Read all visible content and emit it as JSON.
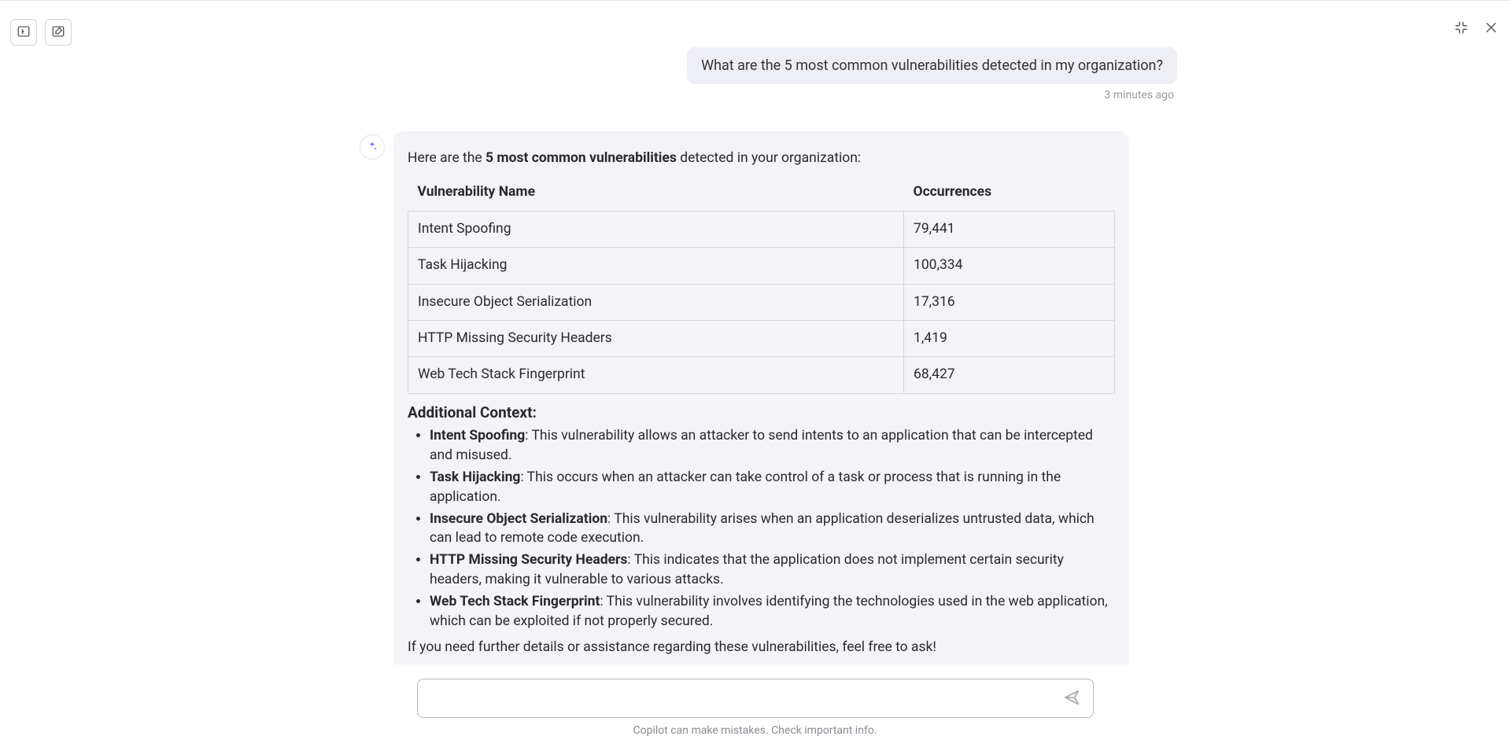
{
  "conversation": {
    "userMessage": "What are the 5 most common vulnerabilities detected in my organization?",
    "userTimestamp": "3 minutes ago",
    "assistant": {
      "intro_before": "Here are the ",
      "intro_bold": "5 most common vulnerabilities",
      "intro_after": " detected in your organization:",
      "table": {
        "headers": {
          "name": "Vulnerability Name",
          "occ": "Occurrences"
        },
        "rows": [
          {
            "name": "Intent Spoofing",
            "occ": "79,441"
          },
          {
            "name": "Task Hijacking",
            "occ": "100,334"
          },
          {
            "name": "Insecure Object Serialization",
            "occ": "17,316"
          },
          {
            "name": "HTTP Missing Security Headers",
            "occ": "1,419"
          },
          {
            "name": "Web Tech Stack Fingerprint",
            "occ": "68,427"
          }
        ]
      },
      "contextHeading": "Additional Context:",
      "contextItems": [
        {
          "term": "Intent Spoofing",
          "desc": ": This vulnerability allows an attacker to send intents to an application that can be intercepted and misused."
        },
        {
          "term": "Task Hijacking",
          "desc": ": This occurs when an attacker can take control of a task or process that is running in the application."
        },
        {
          "term": "Insecure Object Serialization",
          "desc": ": This vulnerability arises when an application deserializes untrusted data, which can lead to remote code execution."
        },
        {
          "term": "HTTP Missing Security Headers",
          "desc": ": This indicates that the application does not implement certain security headers, making it vulnerable to various attacks."
        },
        {
          "term": "Web Tech Stack Fingerprint",
          "desc": ": This vulnerability involves identifying the technologies used in the web application, which can be exploited if not properly secured."
        }
      ],
      "closing": "If you need further details or assistance regarding these vulnerabilities, feel free to ask!"
    }
  },
  "input": {
    "placeholder": ""
  },
  "footer": {
    "disclaimer": "Copilot can make mistakes. Check important info."
  }
}
